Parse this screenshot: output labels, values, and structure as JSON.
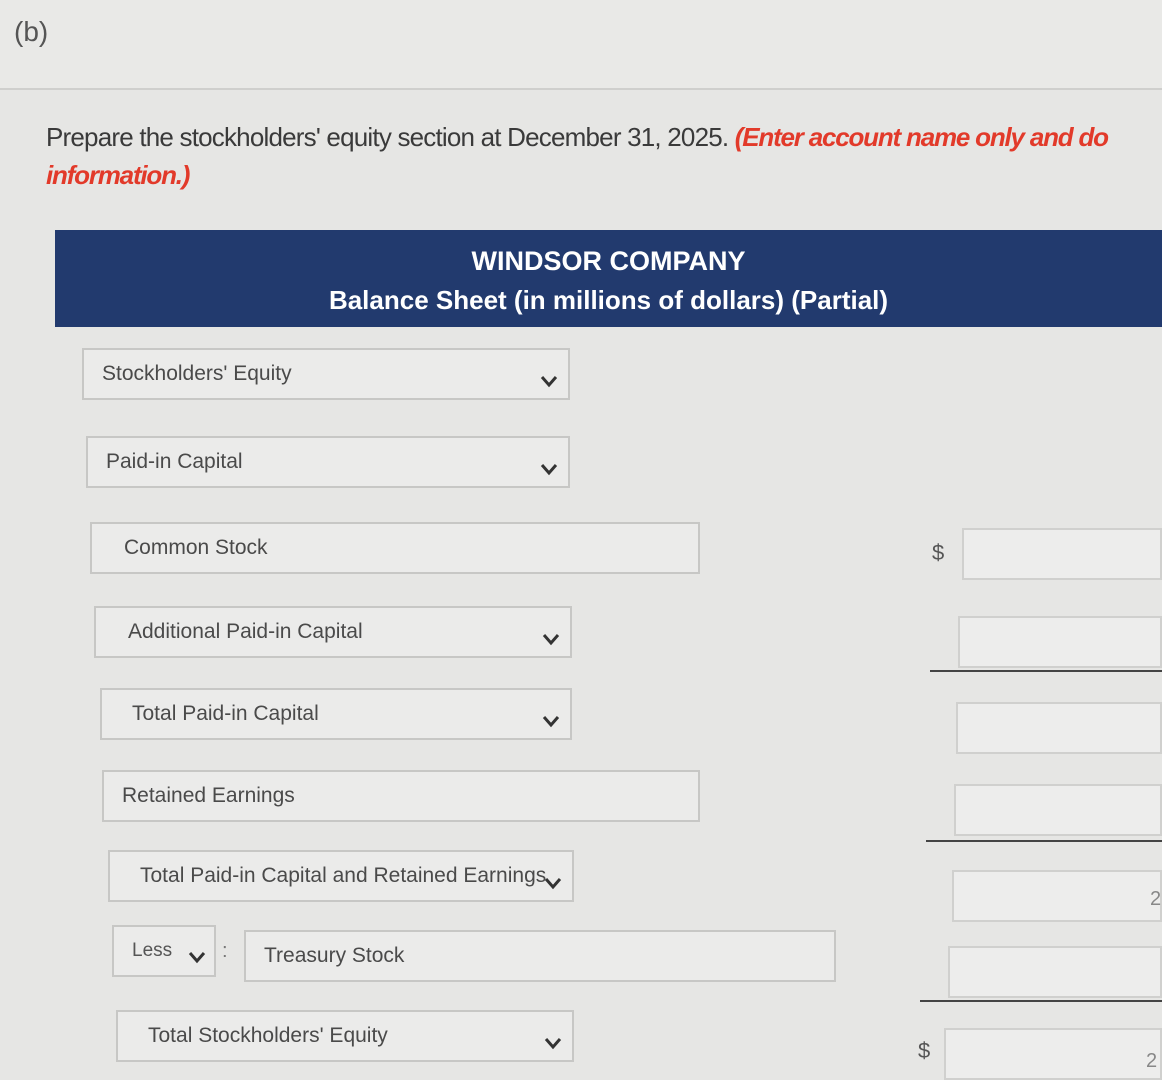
{
  "part_label": "(b)",
  "instructions": {
    "text": "Prepare the stockholders' equity section at December 31, 2025.",
    "red_text": "(Enter account name only and do",
    "line2": "information.)"
  },
  "header": {
    "company": "WINDSOR COMPANY",
    "title": "Balance Sheet (in millions of dollars) (Partial)"
  },
  "rows": {
    "stockholders_equity": "Stockholders' Equity",
    "paid_in_capital": "Paid-in Capital",
    "common_stock": "Common Stock",
    "additional_paid_in_capital": "Additional Paid-in Capital",
    "total_paid_in_capital": "Total Paid-in Capital",
    "retained_earnings": "Retained Earnings",
    "total_pic_and_re": "Total Paid-in Capital and Retained Earnings",
    "less_select": "Less",
    "colon": ":",
    "treasury_stock": "Treasury Stock",
    "total_stockholders_equity": "Total Stockholders' Equity"
  },
  "currency_symbol": "$",
  "edge_digit": "2"
}
